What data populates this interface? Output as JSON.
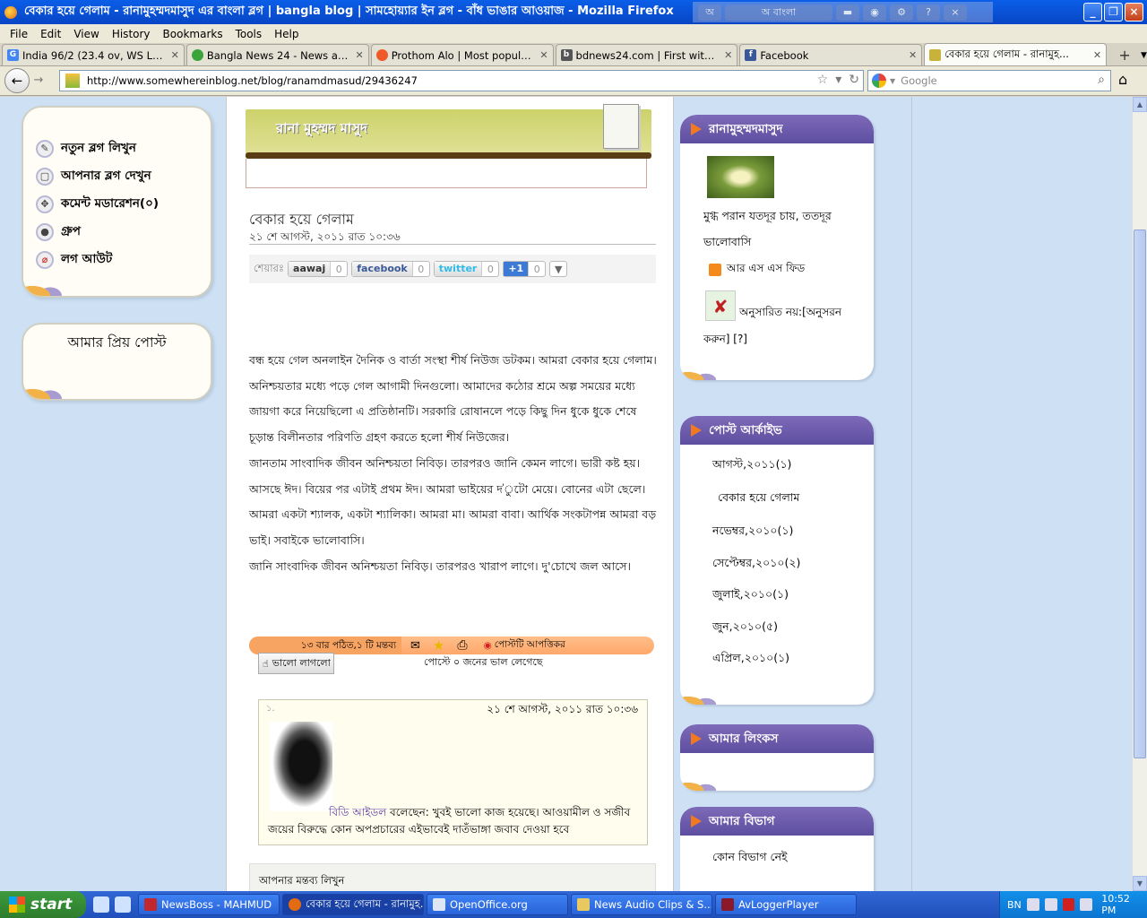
{
  "window": {
    "title": "বেকার হয়ে গেলাম - রানামুহম্মদমাসুদ এর বাংলা ব্লগ | bangla blog | সামহোয়্যার ইন ব্লগ - বাঁধ ভাঙার আওয়াজ - Mozilla Firefox",
    "ime_lang": "অ  বাংলা"
  },
  "menubar": [
    "File",
    "Edit",
    "View",
    "History",
    "Bookmarks",
    "Tools",
    "Help"
  ],
  "tabs": [
    {
      "label": "India 96/2 (23.4 ov, WS Laxma...",
      "icon": "G",
      "color": "#4285f4"
    },
    {
      "label": "Bangla News 24 - News and Ent...",
      "icon": "",
      "color": "#3aa33a"
    },
    {
      "label": "Prothom Alo | Most popular ban...",
      "icon": "",
      "color": "#f05a28"
    },
    {
      "label": "bdnews24.com | First with the ...",
      "icon": "b",
      "color": "#555"
    },
    {
      "label": "Facebook",
      "icon": "f",
      "color": "#3b5998"
    },
    {
      "label": "বেকার হয়ে গেলাম - রানামুহ...",
      "icon": "",
      "color": "#c8b23a"
    }
  ],
  "nav": {
    "url": "http://www.somewhereinblog.net/blog/ranamdmasud/29436247",
    "search_placeholder": "Google"
  },
  "left_menu": {
    "items": [
      {
        "label": "নতুন ব্লগ লিখুন",
        "icon": "pencil-icon"
      },
      {
        "label": "আপনার ব্লগ দেখুন",
        "icon": "page-icon"
      },
      {
        "label": "কমেন্ট মডারেশন(০)",
        "icon": "comment-icon"
      },
      {
        "label": "গ্রুপ",
        "icon": "group-icon"
      },
      {
        "label": "লগ আউট",
        "icon": "logout-icon"
      }
    ],
    "fav_posts_title": "আমার প্রিয় পোস্ট"
  },
  "post": {
    "blogger_name": "রানা মুহম্মদ মাসুদ",
    "title": "বেকার হয়ে গেলাম",
    "date": "২১ শে আগস্ট, ২০১১ রাত ১০:৩৬",
    "share_label": "শেয়ারঃ",
    "share": [
      {
        "label": "aawaj",
        "count": "0"
      },
      {
        "label": "facebook",
        "count": "0"
      },
      {
        "label": "twitter",
        "count": "0"
      },
      {
        "label": "+1",
        "count": "0"
      }
    ],
    "paragraphs": [
      "বন্ধ হয়ে গেল অনলাইন দৈনিক ও বার্তা সংস্থা শীর্ষ নিউজ ডটকম। আমরা বেকার হয়ে গেলাম। অনিশ্চয়তার মধ্যে পড়ে গেল আগামী দিনগুলো। আমাদের কঠোর শ্রমে অল্প সময়ের মধ্যে জায়গা করে নিয়েছিলো এ প্রতিষ্ঠানটি। সরকারি রোষানলে পড়ে কিছু দিন ধুকে ধুকে শেষে চূড়ান্ত বিলীনতার পরিণতি গ্রহণ করতে হলো শীর্ষ নিউজের।",
      "জানতাম সাংবাদিক জীবন অনিশ্চয়তা নিবিড়। তারপরও জানি কেমন লাগে। ভারী কষ্ট হয়। আসছে ঈদ। বিয়ের পর এটাই প্রথম ঈদ। আমরা ভাইয়ের দ'ুটো মেয়ে। বোনের এটা ছেলে। আমরা একটা শ্যালক, একটা শ্যালিকা। আমরা মা। আমরা বাবা। আর্থিক সংকটাপন্ন আমরা বড় ভাই। সবাইকে ভালোবাসি।",
      "জানি সাংবাদিক জীবন অনিশ্চয়তা নিবিড়। তারপরও খারাপ লাগে। দু'চোখে জল আসে।"
    ],
    "stats": "১৩ বার পঠিত,১ টি মন্তব্য",
    "report": "পোস্টটি আপত্তিকর",
    "like_button": "ভালো লাগলো",
    "like_count": "পোস্টে ০ জনের ভাল লেগেছে",
    "write_comment": "আপনার মন্তব্য লিখুন"
  },
  "comment": {
    "number": "১.",
    "date": "২১ শে আগস্ট, ২০১১ রাত ১০:৩৬",
    "author": "বিডি আইডল",
    "said": " বলেছেন: খুবই ভালো কাজ হয়েছে। আওয়ামীল ও সজীব জয়ের বিরুদ্ধে কোন অপপ্রচারের এইভাবেই দাতঁভাঙ্গা জবাব দেওয়া হবে"
  },
  "sidebar": {
    "profile_title": "রানামুহম্মদমাসুদ",
    "tagline": "মুগ্ধ পরান যতদূর চায়, ততদূর ভালোবাসি",
    "rss": "আর এস এস ফিড",
    "follow": "অনুসারিত নয়:[অনুসরন করুন] [?]",
    "archive_title": "পোস্ট আর্কাইভ",
    "archive": [
      "আগস্ট,২০১১(১)",
      "বেকার হয়ে গেলাম",
      "নভেম্বর,২০১০(১)",
      "সেপ্টেম্বর,২০১০(২)",
      "জুলাই,২০১০(১)",
      "জুন,২০১০(৫)",
      "এপ্রিল,২০১০(১)"
    ],
    "links_title": "আমার লিংকস",
    "category_title": "আমার বিভাগ",
    "category_empty": "কোন বিভাগ নেই"
  },
  "taskbar": {
    "start": "start",
    "buttons": [
      "NewsBoss - MAHMUD",
      "বেকার হয়ে গেলাম - রানামুহ...",
      "OpenOffice.org",
      "News Audio Clips & S...",
      "AvLoggerPlayer"
    ],
    "lang": "BN",
    "clock": "10:52 PM"
  }
}
